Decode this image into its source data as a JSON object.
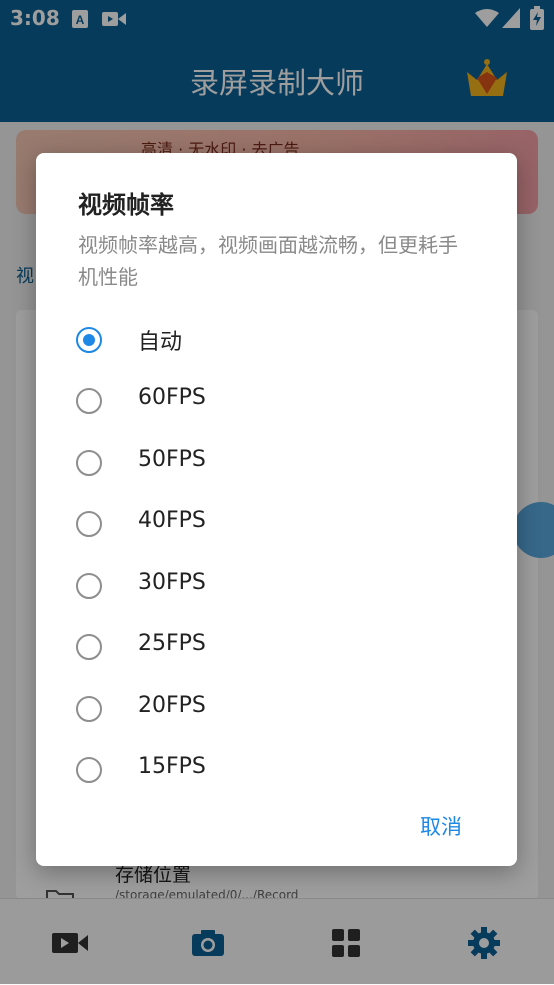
{
  "status_bar": {
    "time": "3:08",
    "icons": [
      "keyboard-a-icon",
      "video-record-icon",
      "wifi-icon",
      "signal-icon",
      "battery-icon"
    ]
  },
  "app_bar": {
    "title": "录屏录制大师",
    "crown_icon": "vip-crown-icon"
  },
  "background": {
    "banner_text": "高清 · 无水印 · 去广告",
    "side_label": "视",
    "storage_label": "存储位置",
    "storage_sub": "/storage/emulated/0/.../Record"
  },
  "bottom_nav": [
    {
      "icon": "video-camera-icon",
      "active": false
    },
    {
      "icon": "camera-icon",
      "active": false
    },
    {
      "icon": "tools-grid-icon",
      "active": false
    },
    {
      "icon": "settings-gear-icon",
      "active": true
    }
  ],
  "dialog": {
    "title": "视频帧率",
    "description": "视频帧率越高，视频画面越流畅，但更耗手机性能",
    "options": [
      {
        "label": "自动",
        "selected": true
      },
      {
        "label": "60FPS",
        "selected": false
      },
      {
        "label": "50FPS",
        "selected": false
      },
      {
        "label": "40FPS",
        "selected": false
      },
      {
        "label": "30FPS",
        "selected": false
      },
      {
        "label": "25FPS",
        "selected": false
      },
      {
        "label": "20FPS",
        "selected": false
      },
      {
        "label": "15FPS",
        "selected": false
      }
    ],
    "cancel_label": "取消"
  },
  "colors": {
    "primary": "#0c5f93",
    "accent": "#1e88e5",
    "scrim": "rgba(0,0,0,0.38)"
  }
}
